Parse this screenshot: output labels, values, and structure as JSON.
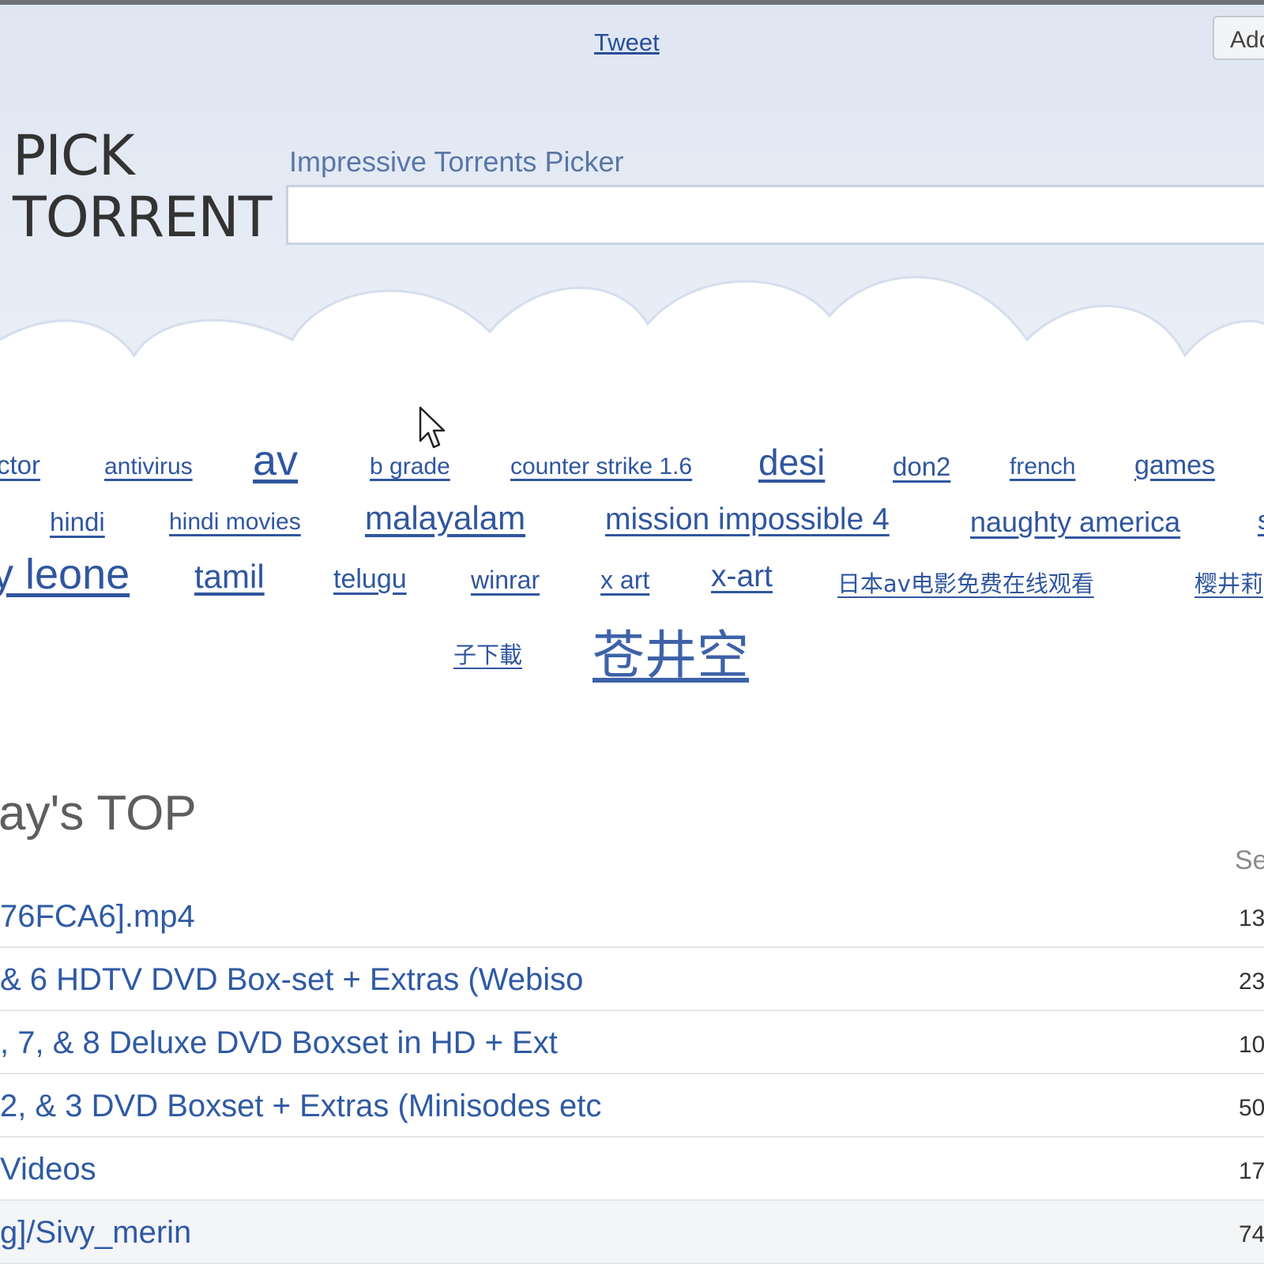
{
  "header": {
    "tweet_label": "Tweet",
    "add_button_label": "Add",
    "logo_line1": "PICK",
    "logo_line2": "TORRENT",
    "tagline": "Impressive Torrents Picker",
    "search_value": ""
  },
  "tag_cloud": {
    "row1": [
      "ctor",
      "antivirus",
      "av",
      "b grade",
      "counter strike 1.6",
      "desi",
      "don2",
      "french",
      "games"
    ],
    "row2": [
      "hindi",
      "hindi movies",
      "malayalam",
      "mission impossible 4",
      "naughty america",
      "s"
    ],
    "row3": [
      "y leone",
      "tamil",
      "telugu",
      "winrar",
      "x art",
      "x-art",
      "日本av电影免费在线观看",
      "樱井莉"
    ],
    "row4": [
      "子下載",
      "苍井空"
    ]
  },
  "top_list": {
    "title": "ay's TOP",
    "seeders_header": "Se",
    "rows": [
      {
        "name": "76FCA6].mp4",
        "count": "13"
      },
      {
        "name": " & 6 HDTV DVD Box-set + Extras (Webiso",
        "count": "23"
      },
      {
        "name": ", 7, & 8 Deluxe DVD Boxset in HD + Ext",
        "count": "10"
      },
      {
        "name": "2, & 3 DVD Boxset + Extras (Minisodes etc",
        "count": "50"
      },
      {
        "name": " Videos",
        "count": "17"
      },
      {
        "name": "g]/Sivy_merin",
        "count": "74"
      }
    ]
  },
  "colors": {
    "link": "#30569f",
    "header_bg": "#e3e9f3",
    "logo_text": "#333333"
  },
  "icons": [
    "mouse-cursor-icon"
  ]
}
